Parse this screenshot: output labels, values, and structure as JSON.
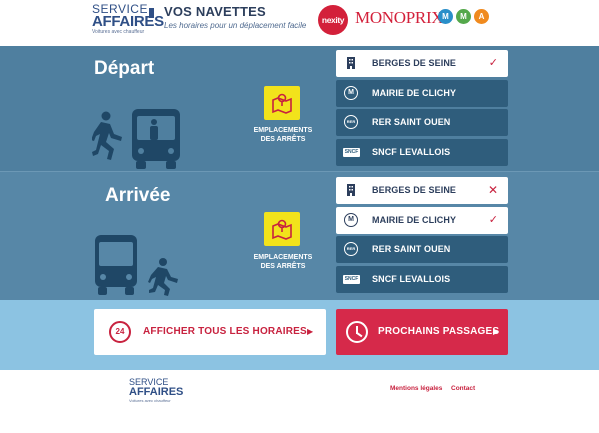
{
  "header": {
    "logo": {
      "line1": "SERVICE",
      "line2": "AFFAIRES",
      "line3": "Voitures avec chauffeur"
    },
    "title": "VOS NAVETTES",
    "subtitle": "Les horaires pour un déplacement facile",
    "partners": {
      "nexity": "nexity",
      "monoprix": "MONOPRIX",
      "mma": [
        "M",
        "M",
        "A"
      ]
    }
  },
  "depart": {
    "title": "Départ",
    "map_label_line1": "EMPLACEMENTS",
    "map_label_line2": "DES ARRÊTS",
    "stops": [
      {
        "label": "BERGES DE SEINE",
        "icon": "building-icon",
        "selected": true,
        "mark": "✓"
      },
      {
        "label": "MAIRIE DE CLICHY",
        "icon": "metro-icon",
        "selected": false,
        "mark": ""
      },
      {
        "label": "RER SAINT OUEN",
        "icon": "rer-icon",
        "selected": false,
        "mark": ""
      },
      {
        "label": "SNCF LEVALLOIS",
        "icon": "sncf-icon",
        "selected": false,
        "mark": ""
      }
    ]
  },
  "arrivee": {
    "title": "Arrivée",
    "map_label_line1": "EMPLACEMENTS",
    "map_label_line2": "DES ARRÊTS",
    "stops": [
      {
        "label": "BERGES DE SEINE",
        "icon": "building-icon",
        "selected": true,
        "mark": "✕"
      },
      {
        "label": "MAIRIE DE CLICHY",
        "icon": "metro-icon",
        "selected": true,
        "mark": "✓"
      },
      {
        "label": "RER SAINT OUEN",
        "icon": "rer-icon",
        "selected": false,
        "mark": ""
      },
      {
        "label": "SNCF LEVALLOIS",
        "icon": "sncf-icon",
        "selected": false,
        "mark": ""
      }
    ]
  },
  "icons": {
    "metro_letter": "M",
    "rer_text": "RER",
    "sncf_text": "SNCF",
    "clock_24": "24"
  },
  "actions": {
    "all_schedules": "AFFICHER TOUS LES HORAIRES",
    "next_departures": "PROCHAINS PASSAGES",
    "arrow": "▶"
  },
  "footer": {
    "logo": {
      "line1": "SERVICE",
      "line2": "AFFAIRES",
      "line3": "Voitures avec chauffeur"
    },
    "legal": "Mentions légales",
    "contact": "Contact"
  },
  "colors": {
    "depart_bg": "#4f7f9f",
    "arrivee_bg": "#5787a7",
    "stop_bg": "#2f5d7c",
    "accent_red": "#c8223f",
    "map_yellow": "#f2e31b",
    "actions_bg": "#8cc3e2"
  }
}
